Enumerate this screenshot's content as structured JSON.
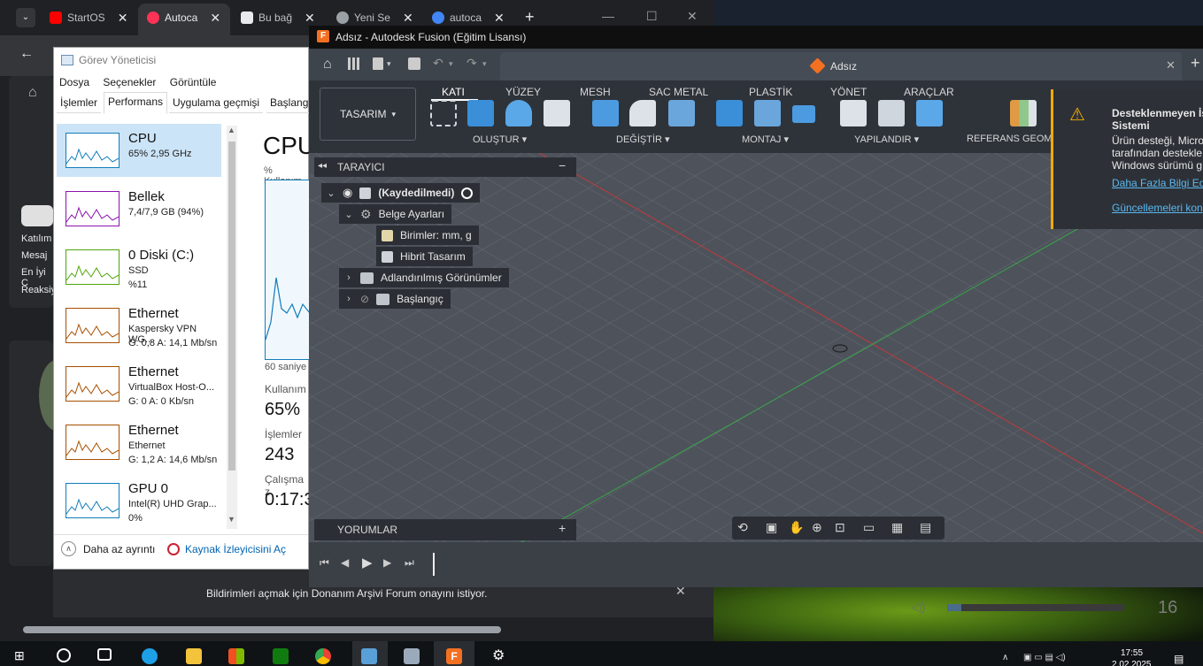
{
  "browser": {
    "tabs": [
      {
        "label": "StartOS",
        "color": "#ff0000"
      },
      {
        "label": "Autoca",
        "color": "#ff3355"
      },
      {
        "label": "Bu bağ",
        "color": "#e8eaed"
      },
      {
        "label": "Yeni Se",
        "color": "#9aa0a6"
      },
      {
        "label": "autoca",
        "color": "#4285f4"
      }
    ],
    "left_texts": [
      "Katılım",
      "Mesaj",
      "En İyi C",
      "Reaksiy"
    ],
    "notification": "Bildirimleri açmak için Donanım Arşivi Forum onayını istiyor."
  },
  "task_manager": {
    "title": "Görev Yöneticisi",
    "menu": [
      "Dosya",
      "Seçenekler",
      "Görüntüle"
    ],
    "tabs": [
      "İşlemler",
      "Performans",
      "Uygulama geçmişi",
      "Başlangı"
    ],
    "items": [
      {
        "name": "CPU",
        "line1": "65% 2,95 GHz",
        "line2": "",
        "color": "#117dbb"
      },
      {
        "name": "Bellek",
        "line1": "7,4/7,9 GB (94%)",
        "line2": "",
        "color": "#8b12ae"
      },
      {
        "name": "0 Diski (C:)",
        "line1": "SSD",
        "line2": "%11",
        "color": "#4da60c"
      },
      {
        "name": "Ethernet",
        "line1": "Kaspersky VPN WG...",
        "line2": "G: 0,8  A: 14,1 Mb/sn",
        "color": "#a74f01"
      },
      {
        "name": "Ethernet",
        "line1": "VirtualBox Host-O...",
        "line2": "G: 0  A: 0 Kb/sn",
        "color": "#a74f01"
      },
      {
        "name": "Ethernet",
        "line1": "Ethernet",
        "line2": "G: 1,2  A: 14,6 Mb/sn",
        "color": "#a74f01"
      },
      {
        "name": "GPU 0",
        "line1": "Intel(R) UHD Grap...",
        "line2": "0%",
        "color": "#117dbb"
      }
    ],
    "detail": {
      "heading": "CPU",
      "usage_label": "% Kullanım",
      "seconds_label": "60 saniye",
      "usage_title": "Kullanım",
      "usage_value": "65%",
      "proc_title": "İşlemler",
      "proc_value": "243",
      "uptime_title": "Çalışma z",
      "uptime_value": "0:17:3"
    },
    "footer_less": "Daha az ayrıntı",
    "footer_resmon": "Kaynak İzleyicisini Aç"
  },
  "fusion": {
    "window_title": "Adsız - Autodesk Fusion (Eğitim Lisansı)",
    "doc_tab": "Adsız",
    "workspace": "TASARIM",
    "ribbon_tabs": [
      "KATI",
      "YÜZEY",
      "MESH",
      "SAC METAL",
      "PLASTİK",
      "YÖNET",
      "ARAÇLAR"
    ],
    "groups": [
      "OLUŞTUR",
      "DEĞİŞTİR",
      "MONTAJ",
      "YAPILANDIR",
      "REFERANS GEOM"
    ],
    "browser_title": "TARAYICI",
    "tree": [
      "(Kaydedilmedi)",
      "Belge Ayarları",
      "Birimler: mm, g",
      "Hibrit Tasarım",
      "Adlandırılmış Görünümler",
      "Başlangıç"
    ],
    "comments": "YORUMLAR",
    "notification": {
      "title": "Desteklenmeyen İş Sistemi",
      "body": "Ürün desteği, Micro tarafından destekle Windows sürümü g",
      "link1": "Daha Fazla Bilgi Edin",
      "link2": "Güncellemeleri kon"
    }
  },
  "taskbar": {
    "time": "17:55",
    "date": "2.02.2025",
    "volume_value": "16"
  }
}
